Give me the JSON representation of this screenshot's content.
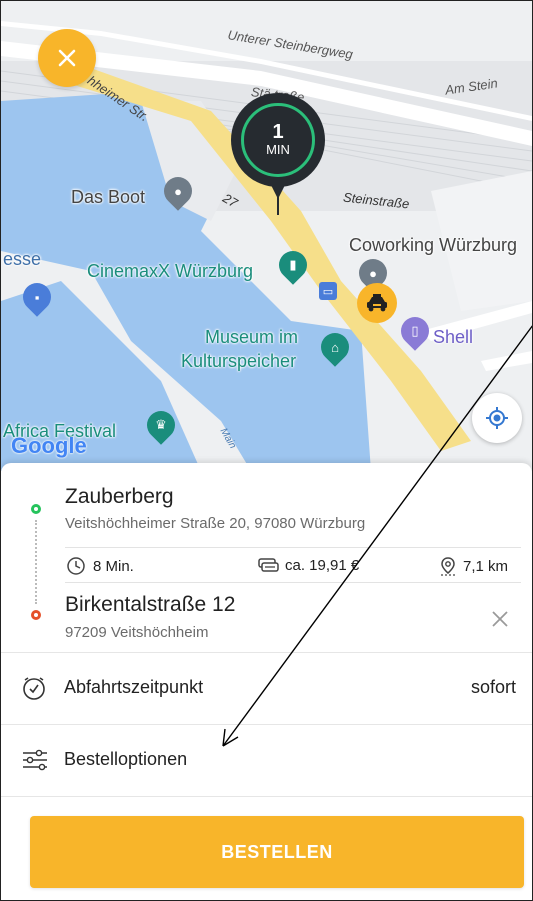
{
  "colors": {
    "accent": "#f8b52a",
    "origin_dot": "#25c35c",
    "destination_dot": "#e5512a",
    "eta_ring": "#2bbf7a",
    "water": "#9dc5ef",
    "road": "#f6df8a"
  },
  "map": {
    "close_icon": "close-icon",
    "eta": {
      "number": "1",
      "unit": "MIN"
    },
    "streets": {
      "unterer_steinbergweg": "Unterer Steinbergweg",
      "am_stein": "Am Stein",
      "steinstrasse": "Steinstraße",
      "steinstrasse_top": "Stä   traße",
      "hochheimer": "hheimer Str.",
      "road_number": "27",
      "main": "Main"
    },
    "places": {
      "das_boot": "Das Boot",
      "coworking": "Coworking Würzburg",
      "esse": "esse",
      "cinemaxx": "CinemaxX Würzburg",
      "museum_line1": "Museum im",
      "museum_line2": "Kulturspeicher",
      "shell": "Shell",
      "africa_festival": "Africa Festival"
    },
    "google_logo": "Google"
  },
  "route": {
    "origin": {
      "title": "Zauberberg",
      "address": "Veitshöchheimer Straße 20, 97080 Würzburg"
    },
    "stats": {
      "duration": "8 Min.",
      "price": "ca. 19,91 €",
      "distance": "7,1 km"
    },
    "destination": {
      "title": "Birkentalstraße 12",
      "address": "97209 Veitshöchheim"
    }
  },
  "departure": {
    "label": "Abfahrtszeitpunkt",
    "value": "sofort"
  },
  "options": {
    "label": "Bestelloptionen"
  },
  "order_button": {
    "label": "BESTELLEN"
  }
}
